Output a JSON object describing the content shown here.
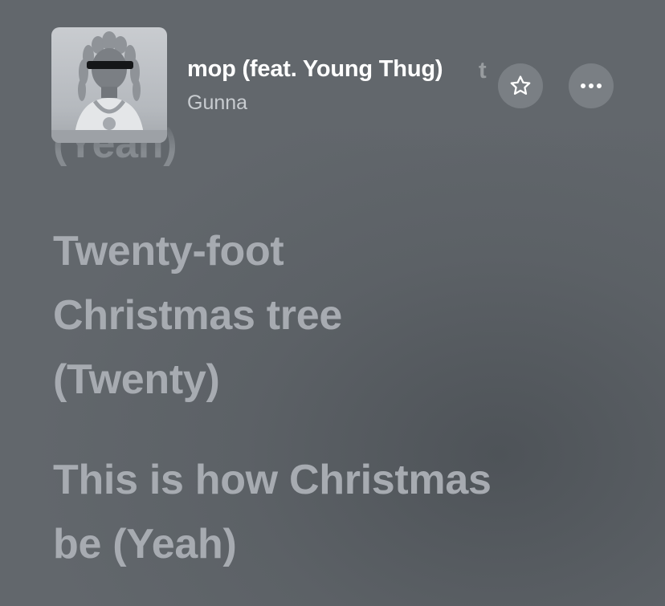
{
  "track": {
    "title": "mop (feat. Young Thug)",
    "title_overflow": "t",
    "artist": "Gunna",
    "artwork": "album-artwork"
  },
  "controls": {
    "favorite_icon": "star-outline-icon",
    "more_icon": "ellipsis-icon"
  },
  "lyrics": {
    "previous_line": "(Yeah)",
    "lines": [
      "Twenty-foot",
      "Christmas tree",
      "(Twenty)",
      "This is how Christmas",
      "be (Yeah)"
    ]
  },
  "colors": {
    "background": "#62676c",
    "lyric_text": "#a7abb1",
    "button_bg": "#7a7f84"
  }
}
